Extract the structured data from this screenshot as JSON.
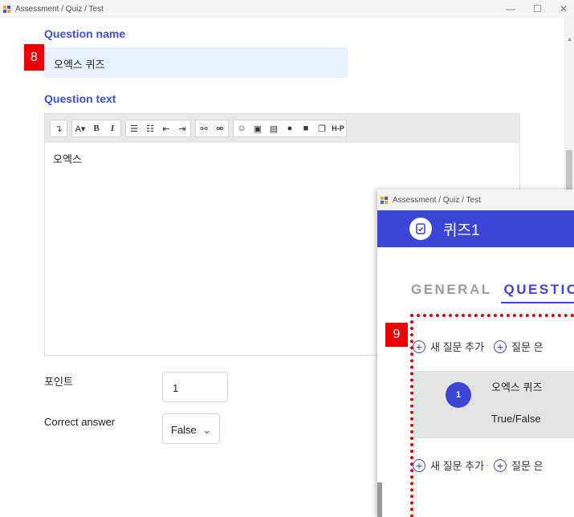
{
  "window1": {
    "title": "Assessment / Quiz / Test",
    "question_name_label": "Question name",
    "question_name_value": "오엑스 퀴즈",
    "question_text_label": "Question text",
    "editor_content": "오엑스",
    "toolbar": {
      "undo": "↴",
      "font_size": "A▾",
      "bold": "B",
      "italic": "I",
      "hp": "H-P"
    },
    "points_label": "포인트",
    "points_value": "1",
    "correct_answer_label": "Correct answer",
    "correct_answer_value": "False",
    "badge": "8"
  },
  "window2": {
    "title": "Assessment / Quiz / Test",
    "quiz_title": "퀴즈1",
    "tabs": [
      "GENERAL",
      "QUESTIO"
    ],
    "add_question": "새 질문 추가",
    "question_bank": "질문 은",
    "badge": "9",
    "question": {
      "number": "1",
      "name": "오엑스 퀴즈",
      "type": "True/False"
    }
  },
  "colors": {
    "accent": "#3b45d6",
    "label_blue": "#3f51d9",
    "badge_red": "#ee0000",
    "input_fill": "#e8f0fe"
  }
}
